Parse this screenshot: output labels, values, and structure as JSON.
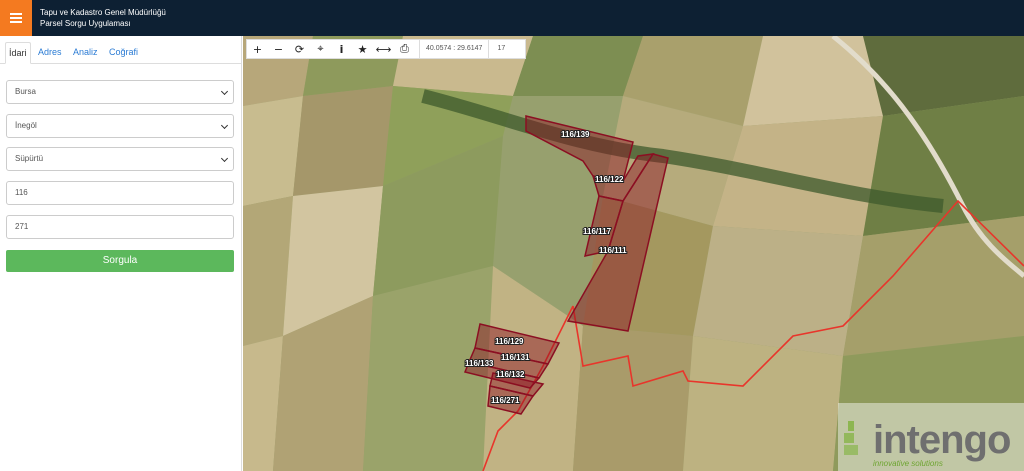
{
  "header": {
    "title_line1": "Tapu ve Kadastro Genel Müdürlüğü",
    "title_line2": "Parsel Sorgu Uygulaması"
  },
  "sidebar": {
    "tabs": [
      {
        "label": "İdari",
        "active": true
      },
      {
        "label": "Adres",
        "active": false
      },
      {
        "label": "Analiz",
        "active": false
      },
      {
        "label": "Coğrafi",
        "active": false
      }
    ],
    "province": "Bursa",
    "district": "İnegöl",
    "neighborhood": "Süpürtü",
    "block_no": "116",
    "parcel_no": "271",
    "query_button": "Sorgula"
  },
  "toolbar": {
    "icons": [
      "zoom-in-icon",
      "zoom-out-icon",
      "refresh-icon",
      "locate-icon",
      "info-icon",
      "favorite-icon",
      "measure-icon",
      "print-icon"
    ],
    "coordinates": "40.0574 : 29.6147",
    "zoom_level": "17"
  },
  "map": {
    "parcels": [
      {
        "label": "116/139"
      },
      {
        "label": "116/122"
      },
      {
        "label": "116/117"
      },
      {
        "label": "116/111"
      },
      {
        "label": "116/129"
      },
      {
        "label": "116/131"
      },
      {
        "label": "116/133"
      },
      {
        "label": "116/132"
      },
      {
        "label": "116/271"
      }
    ],
    "parcel_color": "#8b0f22",
    "boundary_color": "#e8352b"
  },
  "watermark": {
    "brand": "intengo",
    "tagline": "innovative solutions"
  }
}
